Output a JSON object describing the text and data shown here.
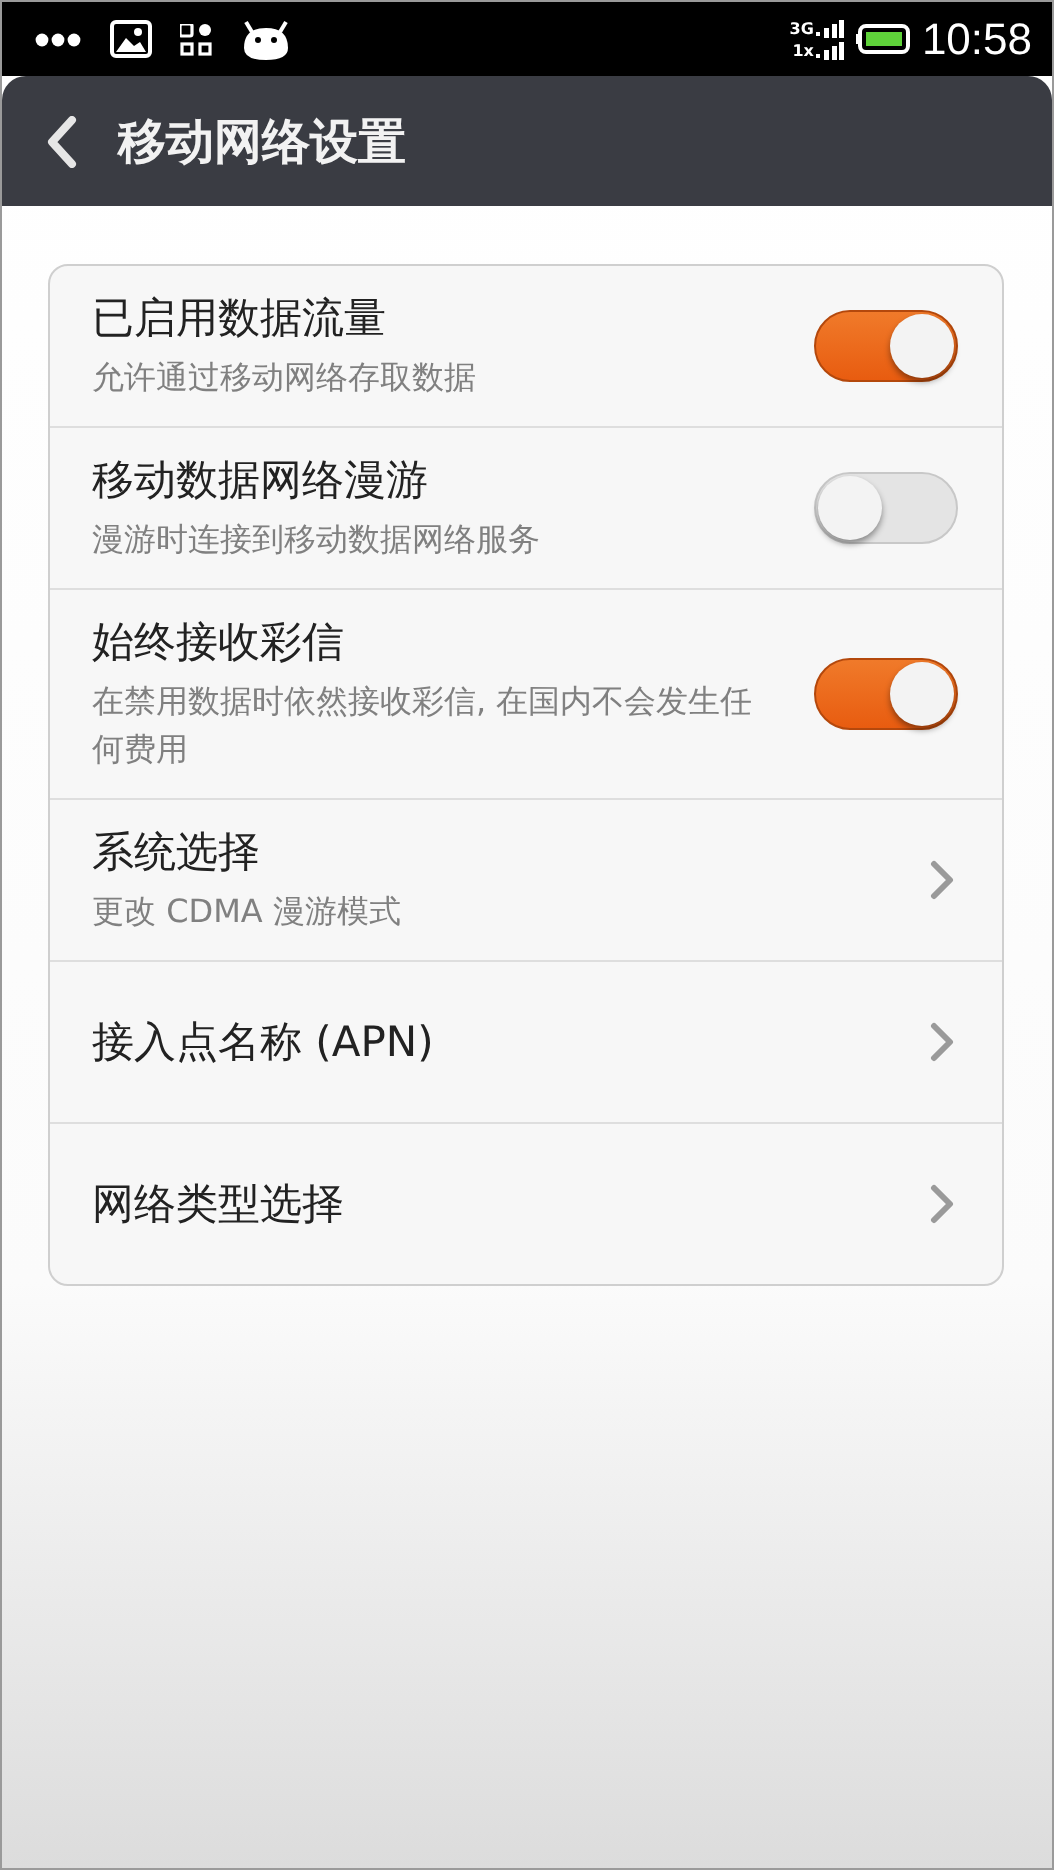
{
  "status_bar": {
    "network_top": "3G",
    "network_bottom": "1x",
    "time": "10:58"
  },
  "title_bar": {
    "title": "移动网络设置"
  },
  "settings": [
    {
      "kind": "toggle",
      "title": "已启用数据流量",
      "subtitle": "允许通过移动网络存取数据",
      "on": true
    },
    {
      "kind": "toggle",
      "title": "移动数据网络漫游",
      "subtitle": "漫游时连接到移动数据网络服务",
      "on": false
    },
    {
      "kind": "toggle",
      "title": "始终接收彩信",
      "subtitle": "在禁用数据时依然接收彩信, 在国内不会发生任何费用",
      "on": true
    },
    {
      "kind": "link",
      "title": "系统选择",
      "subtitle": "更改 CDMA 漫游模式"
    },
    {
      "kind": "link",
      "title": "接入点名称 (APN)"
    },
    {
      "kind": "link",
      "title": "网络类型选择"
    }
  ]
}
